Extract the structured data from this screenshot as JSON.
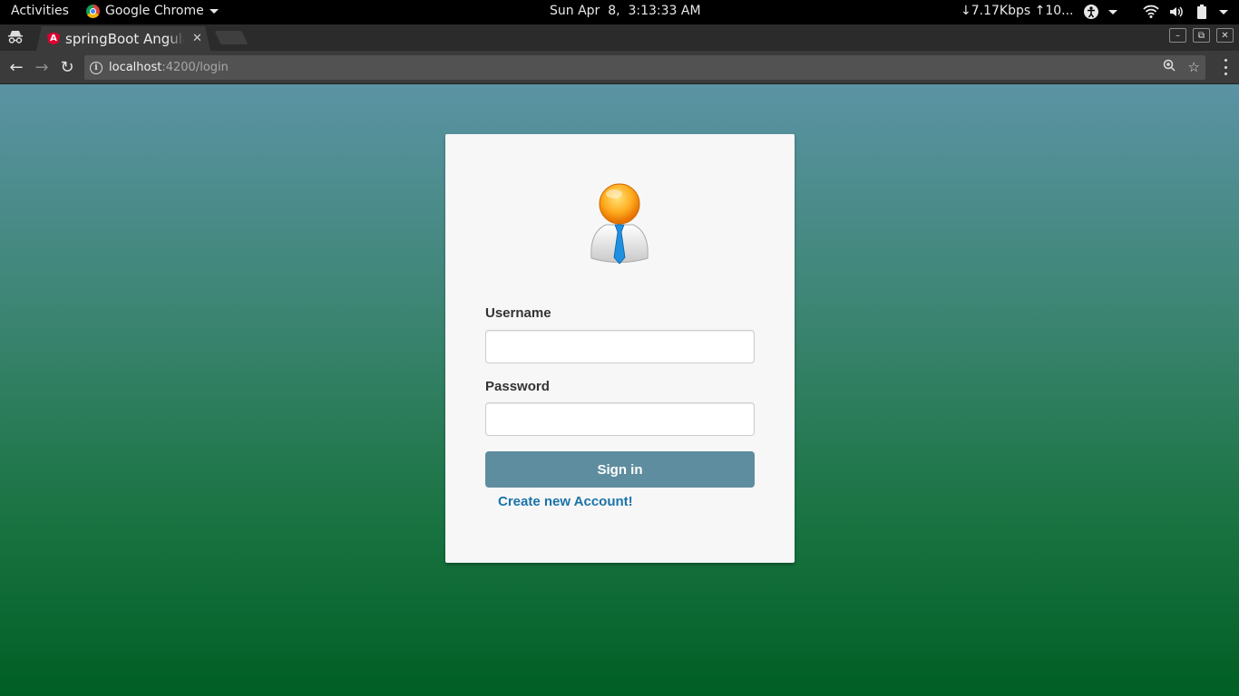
{
  "topbar": {
    "activities": "Activities",
    "app_name": "Google Chrome",
    "clock": "Sun Apr  8,  3:13:33 AM",
    "netspeed": "↓7.17Kbps ↑10..."
  },
  "browser": {
    "tab_title": "springBoot Angular",
    "tab_favicon": "A",
    "url_host": "localhost",
    "url_path": ":4200/login"
  },
  "login": {
    "username_label": "Username",
    "username_value": "",
    "password_label": "Password",
    "password_value": "",
    "signin_label": "Sign in",
    "create_account_label": "Create new Account!"
  },
  "colors": {
    "accent_button": "#5e8d9f",
    "link": "#1a73a8",
    "angular_red": "#dd0031"
  },
  "icons": [
    "incognito-icon",
    "chrome-icon",
    "accessibility-icon",
    "wifi-icon",
    "volume-icon",
    "battery-icon",
    "back-icon",
    "forward-icon",
    "reload-icon",
    "info-icon",
    "zoom-icon",
    "star-icon",
    "menu-icon",
    "user-avatar-icon"
  ]
}
